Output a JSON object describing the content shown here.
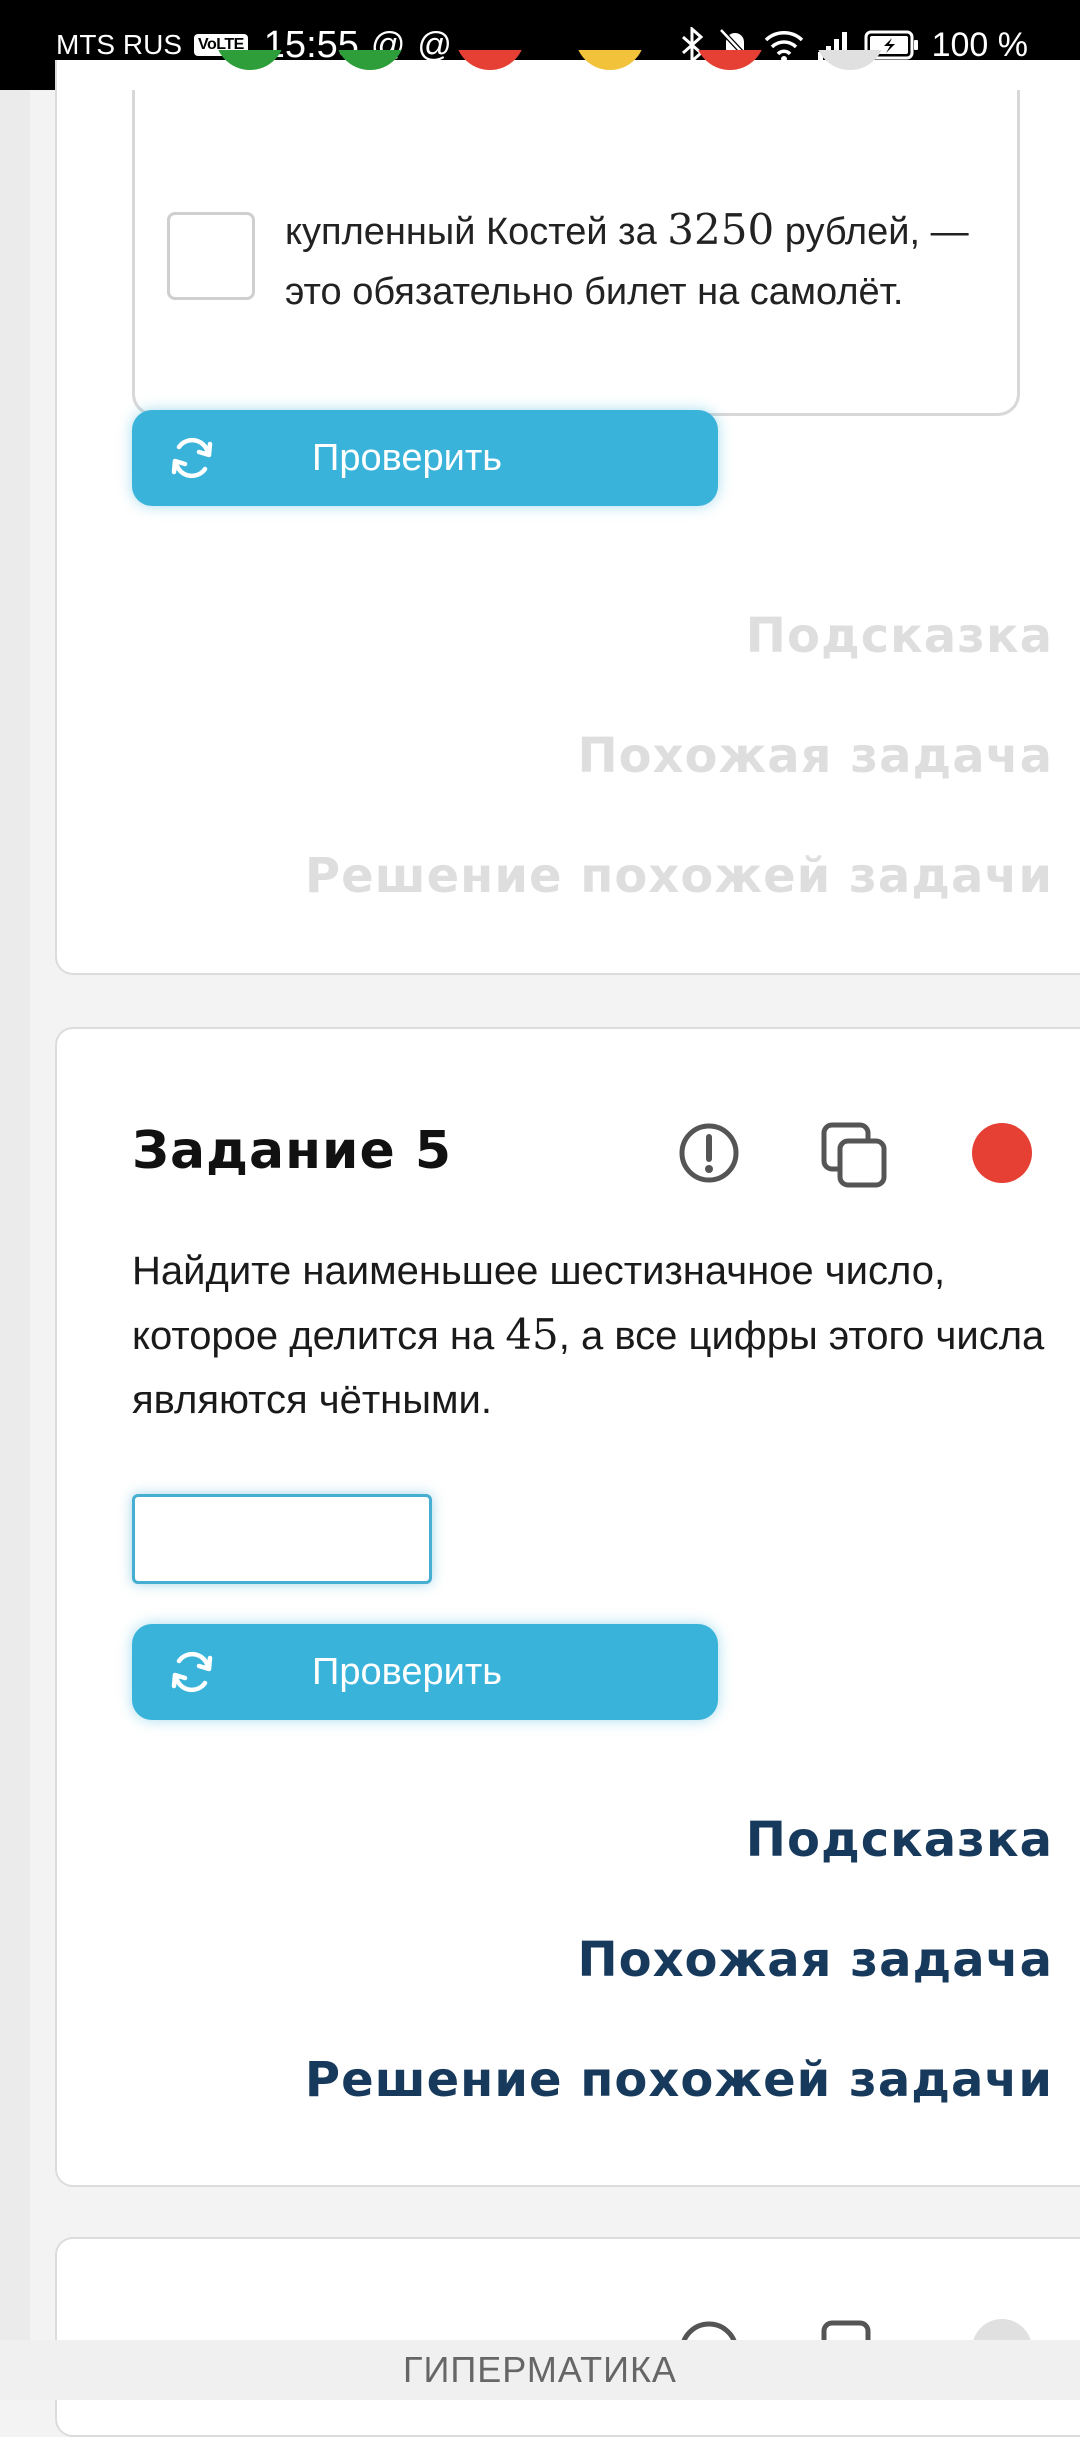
{
  "status_bar": {
    "carrier": "MTS RUS",
    "volte": "VoLTE",
    "time": "15:55",
    "notif_1": "@",
    "notif_2": "@",
    "battery": "100 %"
  },
  "task4": {
    "status_dot_colors": [
      "#2e9e3a",
      "#2e9e3a",
      "#e64035",
      "#f2c23b",
      "#e64035",
      "#e0e0e0"
    ],
    "option_text_1": "купленный Костей за ",
    "option_number": "3250",
    "option_text_2": " рублей, — это обязательно билет на самолёт.",
    "check_label": "Проверить",
    "hint": "Подсказка",
    "similar": "Похожая задача",
    "solution": "Решение похожей задачи"
  },
  "task5": {
    "title": "Задание 5",
    "text_1": "Найдите наименьшее шестизначное число, которое делится на ",
    "number": "45",
    "text_2": ", а все цифры этого числа являются чётными.",
    "answer_value": "",
    "check_label": "Проверить",
    "hint": "Подсказка",
    "similar": "Похожая задача",
    "solution": "Решение похожей задачи",
    "status_color": "#e64035"
  },
  "footer": {
    "brand": "ГИПЕРМАТИКА"
  },
  "colors": {
    "accent": "#3ab3da",
    "link": "#173a5c",
    "link_muted": "#dedede"
  }
}
